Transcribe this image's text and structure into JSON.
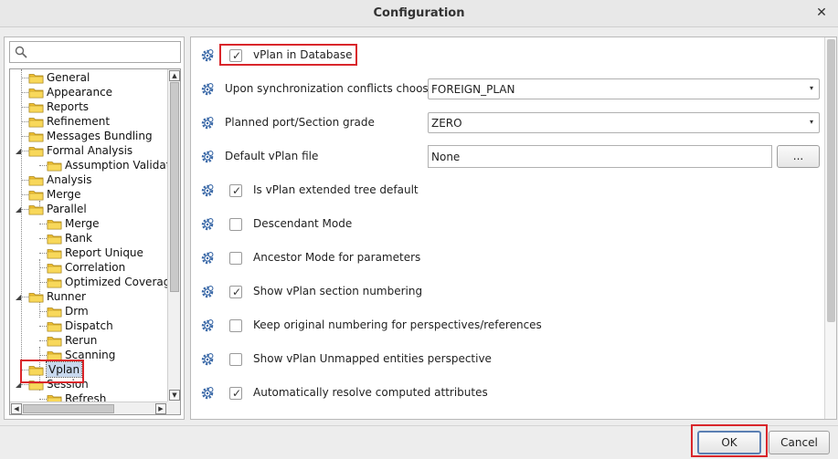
{
  "window": {
    "title": "Configuration",
    "close_symbol": "✕"
  },
  "search": {
    "placeholder": "",
    "value": ""
  },
  "tree": {
    "items": [
      {
        "label": "General",
        "selected": false
      },
      {
        "label": "Appearance",
        "selected": false
      },
      {
        "label": "Reports",
        "selected": false
      },
      {
        "label": "Refinement",
        "selected": false
      },
      {
        "label": "Messages Bundling",
        "selected": false
      },
      {
        "label": "Formal Analysis",
        "selected": false
      },
      {
        "label": "Assumption Validatio",
        "selected": false
      },
      {
        "label": "Analysis",
        "selected": false
      },
      {
        "label": "Merge",
        "selected": false
      },
      {
        "label": "Parallel",
        "selected": false
      },
      {
        "label": "Merge",
        "selected": false
      },
      {
        "label": "Rank",
        "selected": false
      },
      {
        "label": "Report Unique",
        "selected": false
      },
      {
        "label": "Correlation",
        "selected": false
      },
      {
        "label": "Optimized Coverage",
        "selected": false
      },
      {
        "label": "Runner",
        "selected": false
      },
      {
        "label": "Drm",
        "selected": false
      },
      {
        "label": "Dispatch",
        "selected": false
      },
      {
        "label": "Rerun",
        "selected": false
      },
      {
        "label": "Scanning",
        "selected": false
      },
      {
        "label": "Vplan",
        "selected": true
      },
      {
        "label": "Session",
        "selected": false
      },
      {
        "label": "Refresh",
        "selected": false
      }
    ]
  },
  "options": {
    "vplan_in_database": {
      "label": "vPlan in Database",
      "checked": true
    },
    "sync_conflicts": {
      "label": "Upon synchronization conflicts choose",
      "value": "FOREIGN_PLAN"
    },
    "planned_port": {
      "label": "Planned port/Section grade",
      "value": "ZERO"
    },
    "default_vplan_file": {
      "label": "Default vPlan file",
      "value": "None",
      "browse_label": "..."
    },
    "extended_tree_default": {
      "label": "Is vPlan extended tree default",
      "checked": true
    },
    "descendant_mode": {
      "label": "Descendant Mode",
      "checked": false
    },
    "ancestor_mode": {
      "label": "Ancestor Mode for parameters",
      "checked": false
    },
    "section_numbering": {
      "label": "Show vPlan section numbering",
      "checked": true
    },
    "keep_original_numbering": {
      "label": "Keep original numbering for perspectives/references",
      "checked": false
    },
    "unmapped_perspective": {
      "label": "Show vPlan Unmapped entities perspective",
      "checked": false
    },
    "resolve_computed": {
      "label": "Automatically resolve computed attributes",
      "checked": true
    }
  },
  "buttons": {
    "ok_label": "OK",
    "cancel_label": "Cancel"
  },
  "colors": {
    "highlight_box": "#d9262b",
    "selection": "#c8d8ee",
    "folder": "#f2c231"
  },
  "icons": {
    "check": "✓",
    "chevron": "▾"
  }
}
